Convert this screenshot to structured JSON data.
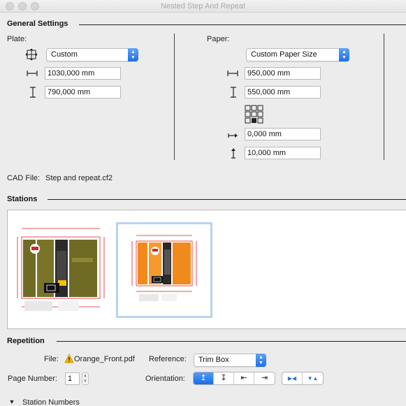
{
  "window": {
    "title": "Nested Step And Repeat"
  },
  "general_settings": {
    "heading": "General Settings",
    "plate": {
      "label": "Plate:",
      "preset": "Custom",
      "width": "1030,000 mm",
      "height": "790,000 mm"
    },
    "paper": {
      "label": "Paper:",
      "preset": "Custom Paper Size",
      "width": "950,000 mm",
      "height": "550,000 mm",
      "horizontal_offset": "0,000 mm",
      "vertical_offset": "10,000 mm"
    },
    "cad_file": {
      "label": "CAD File:",
      "value": "Step and repeat.cf2"
    }
  },
  "stations": {
    "heading": "Stations",
    "count": 2,
    "selected_index": 1
  },
  "repetition": {
    "heading": "Repetition",
    "file_label": "File:",
    "file_value": "Orange_Front.pdf",
    "reference_label": "Reference:",
    "reference_value": "Trim Box",
    "page_number_label": "Page Number:",
    "page_number_value": "1",
    "orientation_label": "Orientation:",
    "orientation_buttons": [
      "↥",
      "↧",
      "⇤",
      "⇥"
    ],
    "flip_buttons": [
      "▶◀",
      "▼▲"
    ]
  },
  "station_numbers": {
    "label": "Station Numbers",
    "disclosure_icon": "triangle-down-icon"
  },
  "colors": {
    "accent": "#1e6fe8",
    "selection": "#b7d3f2",
    "warning": "#f2b600",
    "box_olive": "#6f6b25",
    "box_orange": "#f08a1c",
    "box_dark": "#2a2a2a",
    "die_line": "#e02020"
  }
}
